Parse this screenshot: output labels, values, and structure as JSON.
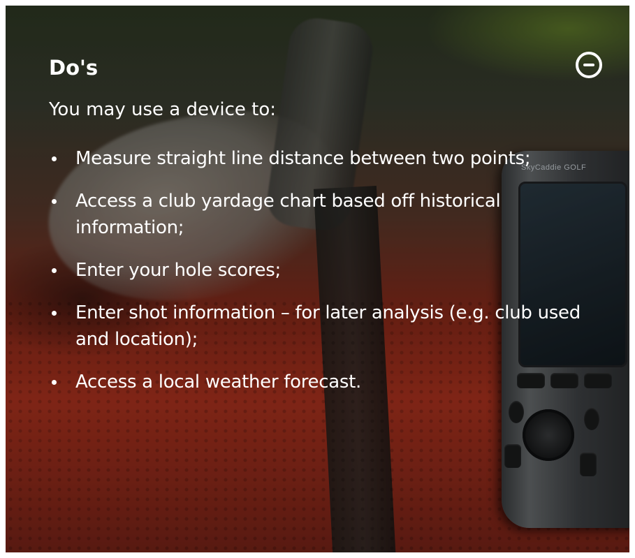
{
  "panel": {
    "title": "Do's",
    "toggle_icon": "minus-circle-icon",
    "intro": "You may use a device to:",
    "items": [
      {
        "label": "Measure straight line distance between two points;"
      },
      {
        "label": "Access a club yardage chart based off historical information;"
      },
      {
        "label": "Enter your hole scores;"
      },
      {
        "label": "Enter shot information – for later analysis (e.g. club used and location);"
      },
      {
        "label": "Access a local weather forecast."
      }
    ]
  },
  "background": {
    "device_brand": "SkyCaddie GOLF"
  },
  "colors": {
    "text": "#ffffff",
    "accent_red": "#b0331f"
  }
}
